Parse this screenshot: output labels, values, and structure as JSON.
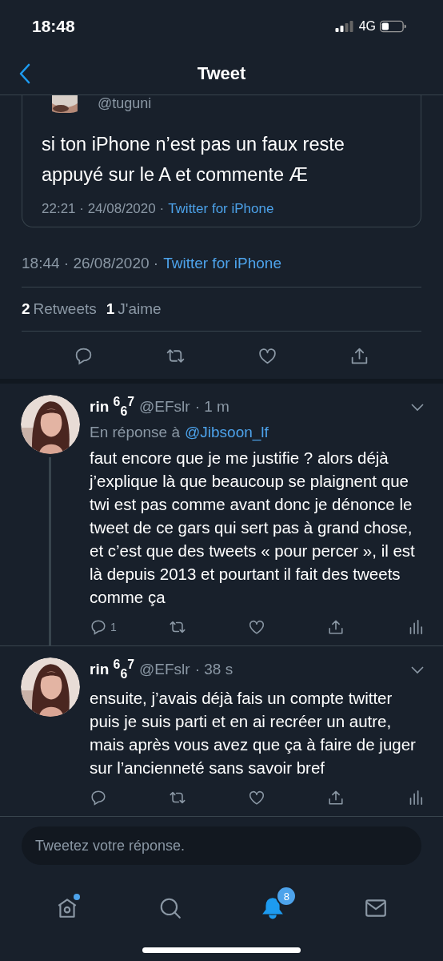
{
  "status_bar": {
    "time": "18:48",
    "network": "4G"
  },
  "header": {
    "title": "Tweet"
  },
  "quoted_tweet": {
    "handle": "@tuguni",
    "text": "si ton iPhone n’est pas un faux reste appuyé sur le A et commente Æ",
    "timestamp": "22:21 · 24/08/2020 ·",
    "source": "Twitter for iPhone"
  },
  "tweet": {
    "timestamp": "18:44 · 26/08/2020 ·",
    "source": "Twitter for iPhone",
    "stats": [
      {
        "count": "2",
        "label": "Retweets"
      },
      {
        "count": "1",
        "label": "J'aime"
      }
    ],
    "actions": [
      {
        "kind": "reply"
      },
      {
        "kind": "retweet"
      },
      {
        "kind": "like"
      },
      {
        "kind": "share"
      }
    ]
  },
  "replies": [
    {
      "name": "rin $^{6}$$_{6}$$^{7}$",
      "handle": "@EFslr",
      "time": "· 1 m",
      "reply_to_label": "En réponse à",
      "reply_to": "@Jibsoon_lf",
      "text": "faut encore que je me justifie ? alors déjà j’explique là que beaucoup se plaignent que twi est pas comme avant donc je dénonce le tweet de ce gars qui sert pas à grand chose, et c’est que des tweets « pour percer », il est là depuis 2013 et pourtant il fait des tweets comme ça",
      "reply_count": "1",
      "thread_line": true
    },
    {
      "name": "rin $^{6}$$_{6}$$^{7}$",
      "handle": "@EFslr",
      "time": "· 38 s",
      "text": "ensuite, j’avais déjà fais un compte twitter puis je suis parti et en ai recréer un autre, mais après vous avez que ça à faire de juger sur l’ancienneté sans savoir bref",
      "thread_line": false
    }
  ],
  "compose": {
    "placeholder": "Tweetez votre réponse."
  },
  "tab_bar": [
    {
      "kind": "home",
      "selected": false,
      "dot": true
    },
    {
      "kind": "search",
      "selected": false,
      "dot": false
    },
    {
      "kind": "notifications",
      "selected": true,
      "badge": "8",
      "dot": false
    },
    {
      "kind": "messages",
      "selected": false,
      "dot": false
    }
  ]
}
